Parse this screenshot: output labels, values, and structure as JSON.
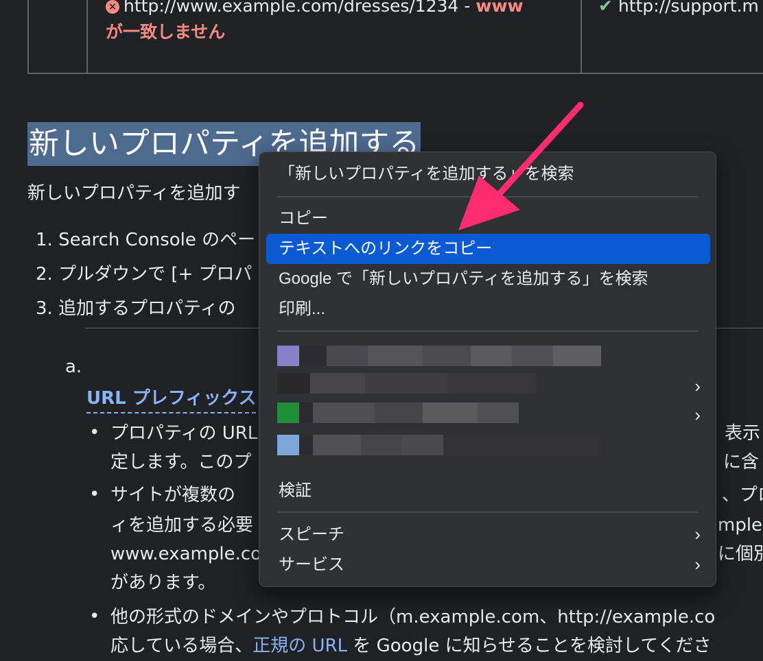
{
  "table": {
    "cell1_url": "http://www.example.com/dresses/1234 - ",
    "cell1_warn1": "www",
    "cell1_warn2": "が一致しません",
    "cell2_url": "http://support.m"
  },
  "heading": "新しいプロパティを追加する",
  "intro": "新しいプロパティを追加す",
  "steps": [
    "1. Search Console のペー",
    "2. プルダウンで [+ プロパ",
    "3. 追加するプロパティの"
  ],
  "sub_label": "a.",
  "sub_link": "URL プレフィックス",
  "bullets": {
    "b1_line1": "プロパティの URL",
    "b1_line1_right": "表示さ",
    "b1_line2": "定します。このプ",
    "b1_line2_right": "に含",
    "b2_line1": "サイトが複数の",
    "b2_line1_right": "、プロ",
    "b2_line2": "ィを追加する必要",
    "b2_line2_right": "mple.",
    "b2_line3": "www.example.co",
    "b2_line3_right": "に個別",
    "b2_line4": "があります。",
    "b3_line1": "他の形式のドメインやプロトコル（m.example.com、http://example.co",
    "b3_line2_a": "応している場合、",
    "b3_line2_link": "正規の URL",
    "b3_line2_b": " を Google に知らせることを検討してくださ"
  },
  "menu": {
    "search_selection": "「新しいプロパティを追加する」を検索",
    "copy": "コピー",
    "copy_link_to_text": "テキストへのリンクをコピー",
    "search_google": "Google で「新しいプロパティを追加する」を検索",
    "print": "印刷...",
    "inspect": "検証",
    "speech": "スピーチ",
    "services": "サービス"
  },
  "icons": {
    "error": "x-circle-icon",
    "success": "check-icon",
    "submenu": "chevron-right-icon"
  },
  "colors": {
    "background": "#202124",
    "menu_bg": "#2f3033",
    "selection": "#0a5ad4",
    "heading_highlight": "#4d6a8f",
    "arrow": "#ff2d6f",
    "link": "#8ab4f8",
    "warning": "#f28b82"
  }
}
